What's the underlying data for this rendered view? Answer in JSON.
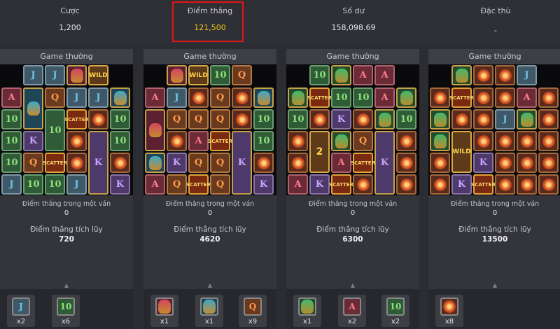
{
  "header": {
    "bet_label": "Cược",
    "bet_value": "1,200",
    "win_label": "Điểm thắng",
    "win_value": "121,500",
    "balance_label": "Số dư",
    "balance_value": "158,098.69",
    "special_label": "Đặc thù",
    "special_value": "-"
  },
  "panels": [
    {
      "title": "Game thường",
      "round_win_label": "Điểm thắng trong một ván",
      "round_win_value": "0",
      "total_label": "Điểm thắng tích lũy",
      "total_value": "720",
      "tally": [
        {
          "icon": "j-icon",
          "count": "x2"
        },
        {
          "icon": "ten-icon",
          "count": "x6"
        }
      ]
    },
    {
      "title": "Game thường",
      "round_win_label": "Điểm thắng trong một ván",
      "round_win_value": "0",
      "total_label": "Điểm thắng tích lũy",
      "total_value": "4620",
      "tally": [
        {
          "icon": "red-mask-icon",
          "count": "x1"
        },
        {
          "icon": "blue-mask-icon",
          "count": "x1"
        },
        {
          "icon": "q-icon",
          "count": "x9"
        }
      ]
    },
    {
      "title": "Game thường",
      "round_win_label": "Điểm thắng trong một ván",
      "round_win_value": "0",
      "total_label": "Điểm thắng tích lũy",
      "total_value": "6300",
      "tally": [
        {
          "icon": "green-mask-icon",
          "count": "x1"
        },
        {
          "icon": "a-icon",
          "count": "x2"
        },
        {
          "icon": "ten-icon",
          "count": "x2"
        }
      ]
    },
    {
      "title": "Game thường",
      "round_win_label": "Điểm thắng trong một ván",
      "round_win_value": "0",
      "total_label": "Điểm thắng tích lũy",
      "total_value": "13500",
      "tally": [
        {
          "icon": "flower-icon",
          "count": "x8"
        }
      ]
    }
  ],
  "symbols": {
    "j": "J",
    "ten": "10",
    "a": "A",
    "q": "Q",
    "k": "K",
    "wild": "WILD",
    "scatter": "SCATTER",
    "wild2": "2"
  },
  "colors": {
    "highlight": "#e11515",
    "win_value": "#f2c614",
    "background": "#2b2d33"
  }
}
